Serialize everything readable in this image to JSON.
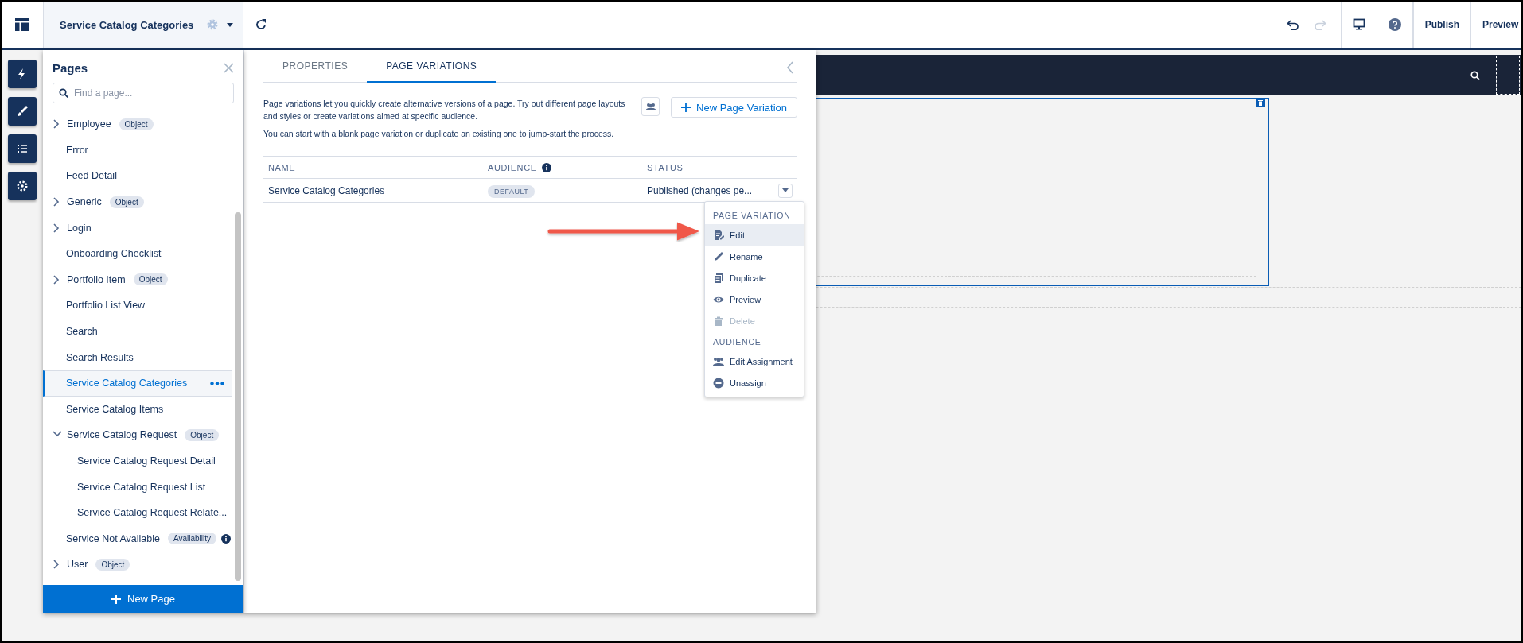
{
  "topbar": {
    "page_title": "Service Catalog Categories",
    "actions": [
      "Publish",
      "Preview"
    ]
  },
  "pages_panel": {
    "title": "Pages",
    "search": {
      "placeholder": "Find a page..."
    },
    "items": [
      {
        "label": "Employee",
        "badge": "Object",
        "expanded": false,
        "selected": false
      },
      {
        "label": "Error",
        "selected": false
      },
      {
        "label": "Feed Detail",
        "selected": false
      },
      {
        "label": "Generic",
        "badge": "Object",
        "expanded": false,
        "selected": false
      },
      {
        "label": "Login",
        "expanded": false,
        "selected": false
      },
      {
        "label": "Onboarding Checklist",
        "selected": false
      },
      {
        "label": "Portfolio Item",
        "badge": "Object",
        "expanded": false,
        "selected": false
      },
      {
        "label": "Portfolio List View",
        "selected": false
      },
      {
        "label": "Search",
        "selected": false
      },
      {
        "label": "Search Results",
        "selected": false
      },
      {
        "label": "Service Catalog Categories",
        "selected": true
      },
      {
        "label": "Service Catalog Items",
        "selected": false
      },
      {
        "label": "Service Catalog Request",
        "badge": "Object",
        "expanded": true,
        "selected": false,
        "children": [
          {
            "label": "Service Catalog Request Detail",
            "selected": false
          },
          {
            "label": "Service Catalog Request List",
            "selected": false
          },
          {
            "label": "Service Catalog Request Relate...",
            "selected": false
          }
        ]
      },
      {
        "label": "Service Not Available",
        "badge": "Availability",
        "info": true,
        "selected": false
      },
      {
        "label": "User",
        "badge": "Object",
        "expanded": false,
        "selected": false
      }
    ],
    "new_page_button": "New Page"
  },
  "properties_panel": {
    "tabs": [
      {
        "label": "PROPERTIES",
        "selected": false
      },
      {
        "label": "PAGE VARIATIONS",
        "selected": true
      }
    ],
    "description": [
      "Page variations let you quickly create alternative versions of a page. Try out different page layouts and styles or create variations aimed at specific audience.",
      "You can start with a blank page variation or duplicate an existing one to jump-start the process."
    ],
    "new_variation_button": "New Page Variation",
    "table": {
      "columns": [
        {
          "label": "NAME"
        },
        {
          "label": "AUDIENCE",
          "info": true
        },
        {
          "label": "STATUS"
        }
      ],
      "rows": [
        {
          "name": "Service Catalog Categories",
          "audience": "DEFAULT",
          "status": "Published (changes pe..."
        }
      ]
    },
    "menu": {
      "sections": [
        {
          "heading": "PAGE VARIATION",
          "items": [
            {
              "label": "Edit",
              "selected": true,
              "disabled": false
            },
            {
              "label": "Rename",
              "selected": false,
              "disabled": false
            },
            {
              "label": "Duplicate",
              "selected": false,
              "disabled": false
            },
            {
              "label": "Preview",
              "selected": false,
              "disabled": false
            },
            {
              "label": "Delete",
              "selected": false,
              "disabled": true
            }
          ]
        },
        {
          "heading": "AUDIENCE",
          "items": [
            {
              "label": "Edit Assignment",
              "selected": false,
              "disabled": false
            },
            {
              "label": "Unassign",
              "selected": false,
              "disabled": false
            }
          ]
        }
      ]
    }
  }
}
